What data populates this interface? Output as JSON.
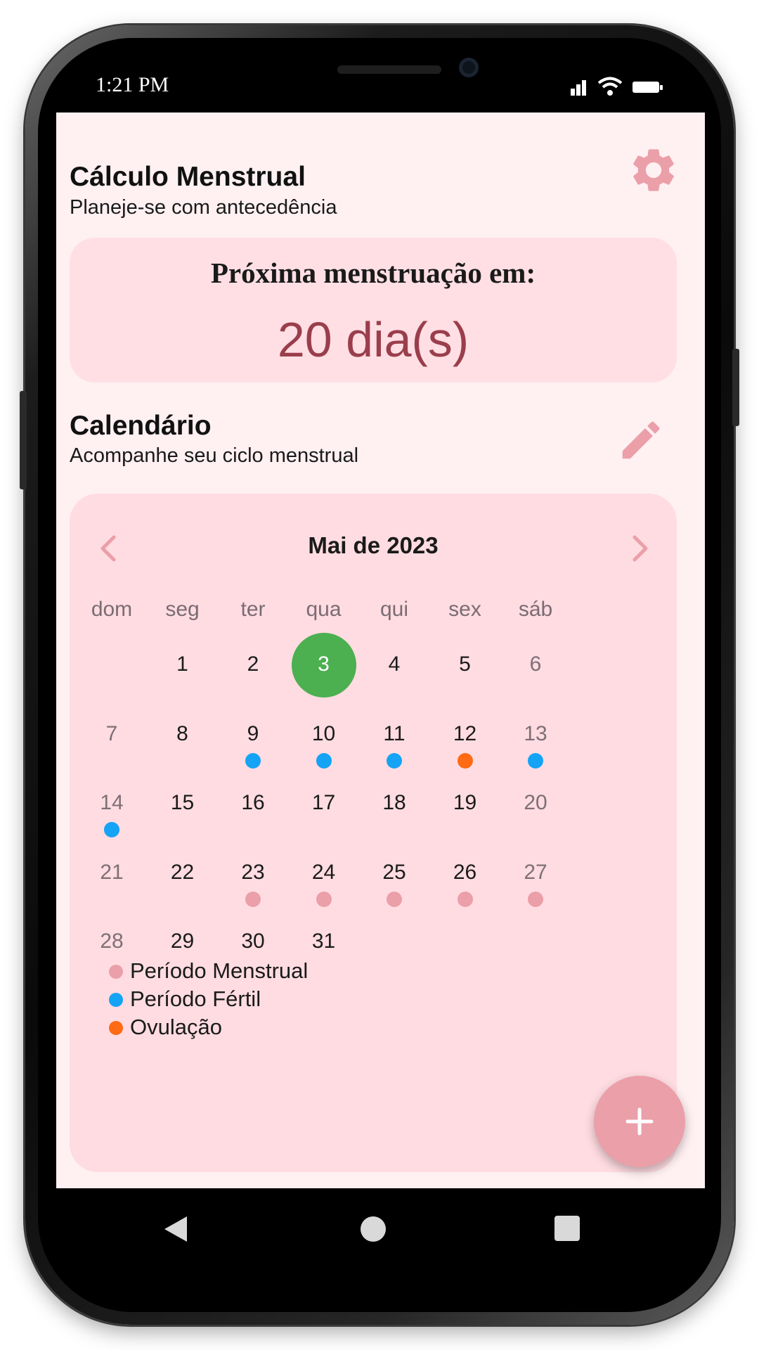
{
  "status_bar": {
    "time": "1:21 PM"
  },
  "header": {
    "title": "Cálculo Menstrual",
    "subtitle": "Planeje-se com antecedência",
    "settings_icon": "gear-icon"
  },
  "next_period": {
    "label": "Próxima menstruação em:",
    "value": "20 dia(s)"
  },
  "calendar_section": {
    "title": "Calendário",
    "subtitle": "Acompanhe seu ciclo menstrual",
    "edit_icon": "pencil-icon"
  },
  "calendar": {
    "month_label": "Mai de 2023",
    "weekdays": [
      "dom",
      "seg",
      "ter",
      "qua",
      "qui",
      "sex",
      "sáb"
    ],
    "first_weekday_index": 1,
    "days_in_month": 31,
    "today": 3,
    "markers": {
      "9": "fertile",
      "10": "fertile",
      "11": "fertile",
      "12": "ovulation",
      "13": "fertile",
      "14": "fertile",
      "23": "menstrual",
      "24": "menstrual",
      "25": "menstrual",
      "26": "menstrual",
      "27": "menstrual"
    }
  },
  "legend": [
    {
      "label": "Período Menstrual",
      "color": "#eb9fa8"
    },
    {
      "label": "Período Fértil",
      "color": "#14a3f5"
    },
    {
      "label": "Ovulação",
      "color": "#ff6a14"
    }
  ],
  "colors": {
    "menstrual": "#eb9fa8",
    "fertile": "#14a3f5",
    "ovulation": "#ff6a14",
    "today": "#4caf50",
    "accent": "#eb9fa8",
    "screen_bg": "#fff0f2",
    "card_bg": "#ffdce2"
  },
  "fab": {
    "icon": "plus-icon"
  },
  "system_nav": {
    "back_icon": "back-triangle-icon",
    "home_icon": "home-circle-icon",
    "recents_icon": "recents-square-icon"
  }
}
